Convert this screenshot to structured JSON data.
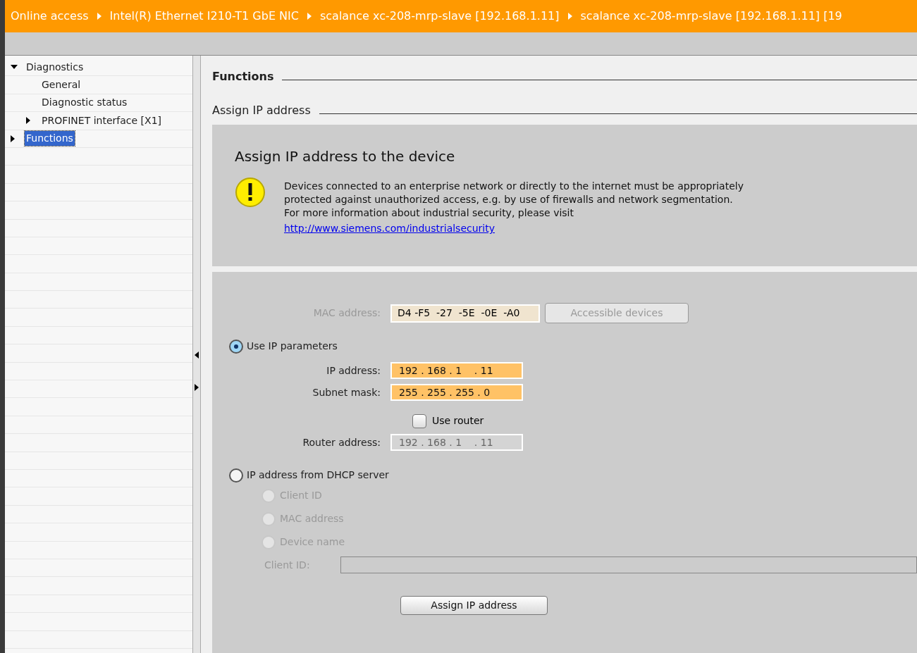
{
  "breadcrumb": [
    "Online access",
    "Intel(R) Ethernet I210-T1 GbE NIC",
    "scalance xc-208-mrp-slave [192.168.1.11]",
    "scalance xc-208-mrp-slave [192.168.1.11] [19"
  ],
  "tree": [
    {
      "label": "Diagnostics",
      "expanded": true,
      "selected": false,
      "children": [
        {
          "label": "General",
          "selected": false
        },
        {
          "label": "Diagnostic status",
          "selected": false
        },
        {
          "label": "PROFINET interface [X1]",
          "expanded": false,
          "selected": false
        }
      ]
    },
    {
      "label": "Functions",
      "expanded": false,
      "selected": true
    }
  ],
  "section_title": "Functions",
  "subsection_title": "Assign IP address",
  "notice": {
    "title": "Assign IP address to the device",
    "text": "Devices connected to an enterprise network or directly to the internet must be appropriately protected against unauthorized access, e.g. by use of firewalls and network segmentation.",
    "more": "For more information about industrial security, please visit",
    "link": "http://www.siemens.com/industrialsecurity"
  },
  "mac": {
    "label": "MAC address:",
    "value": "D4 -F5  -27  -5E  -0E  -A0",
    "disabled": true
  },
  "accessible_button": {
    "label": "Accessible devices",
    "disabled": true
  },
  "use_ip": {
    "label": "Use IP parameters",
    "selected": true
  },
  "ip_address": {
    "label": "IP address:",
    "value": "192 . 168 . 1    . 11",
    "disabled": false
  },
  "subnet_mask": {
    "label": "Subnet mask:",
    "value": "255 . 255 . 255 . 0",
    "disabled": false
  },
  "use_router": {
    "label": "Use router",
    "checked": false
  },
  "router_address": {
    "label": "Router address:",
    "value": "192 . 168 . 1    . 11",
    "disabled": true
  },
  "dhcp": {
    "label": "IP address from DHCP server",
    "selected": false
  },
  "dhcp_options": [
    {
      "label": "Client ID",
      "selected": false,
      "disabled": true
    },
    {
      "label": "MAC address",
      "selected": false,
      "disabled": true
    },
    {
      "label": "Device name",
      "selected": false,
      "disabled": true
    }
  ],
  "client_id": {
    "label": "Client ID:",
    "disabled": true
  },
  "assign_button": {
    "label": "Assign IP address"
  }
}
